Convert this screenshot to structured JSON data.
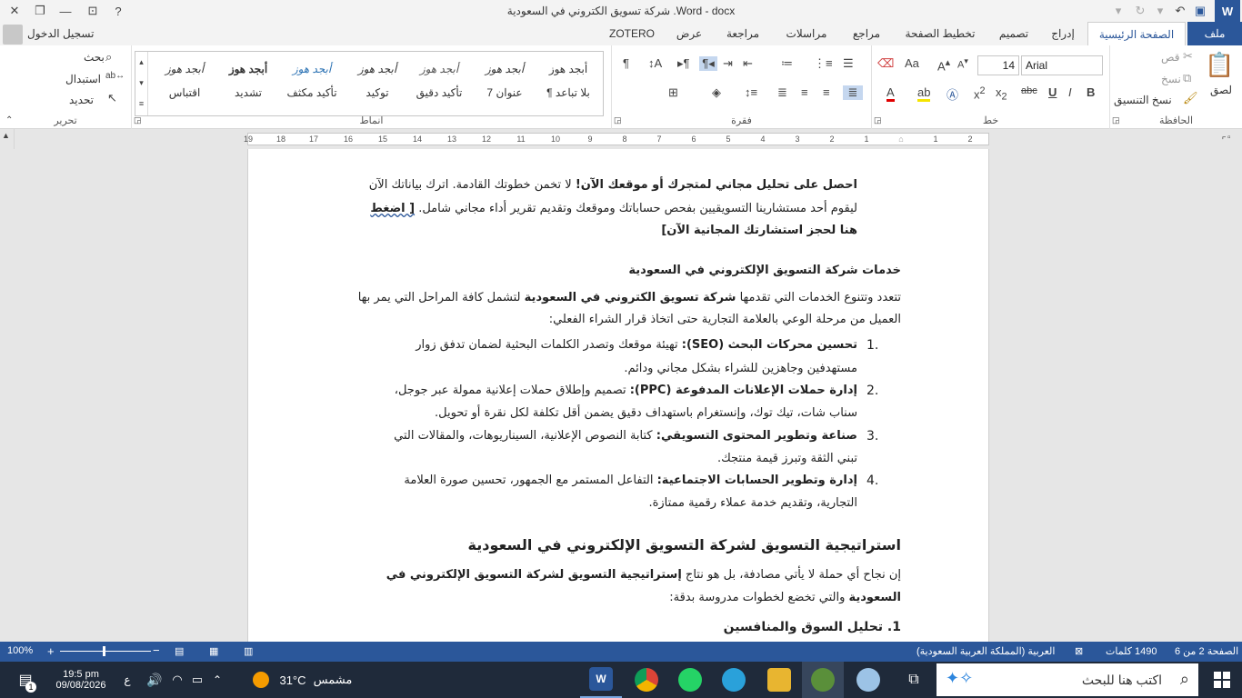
{
  "window": {
    "title": "شركة تسويق الكتروني في السعودية .Word - docx",
    "signin": "تسجيل الدخول"
  },
  "tabs": [
    {
      "label": "ملف"
    },
    {
      "label": "الصفحة الرئيسية"
    },
    {
      "label": "إدراج"
    },
    {
      "label": "تصميم"
    },
    {
      "label": "تخطيط الصفحة"
    },
    {
      "label": "مراجع"
    },
    {
      "label": "مراسلات"
    },
    {
      "label": "مراجعة"
    },
    {
      "label": "عرض"
    },
    {
      "label": "ZOTERO"
    }
  ],
  "ribbon": {
    "clipboard": {
      "paste": "لصق",
      "cut": "قص",
      "copy": "نسخ",
      "format_painter": "نسخ التنسيق",
      "label": "الحافظة"
    },
    "font": {
      "name": "Arial",
      "size": "14",
      "label": "خط"
    },
    "paragraph": {
      "label": "فقرة"
    },
    "styles": {
      "label": "أنماط",
      "items": [
        {
          "sample": "أبجد هوز",
          "name": "¶ بلا تباعد"
        },
        {
          "sample": "أبجد هوز",
          "name": "عنوان 7"
        },
        {
          "sample": "أبجد هوز",
          "name": "تأكيد دقيق"
        },
        {
          "sample": "أبجد هوز",
          "name": "توكيد"
        },
        {
          "sample": "أبجد هوز",
          "name": "تأكيد مكثف"
        },
        {
          "sample": "أبجد هوز",
          "name": "تشديد"
        },
        {
          "sample": "أبجد هوز",
          "name": "اقتباس"
        }
      ]
    },
    "editing": {
      "find": "بحث",
      "replace": "استبدال",
      "select": "تحديد",
      "label": "تحرير"
    }
  },
  "ruler": {
    "ticks": [
      "2",
      "1",
      "",
      "1",
      "2",
      "3",
      "4",
      "5",
      "6",
      "7",
      "8",
      "9",
      "10",
      "11",
      "12",
      "13",
      "14",
      "15",
      "16",
      "17",
      "18",
      "19"
    ]
  },
  "document": {
    "p1": {
      "line1_bold": "احصل على تحليل مجاني لمتجرك أو موقعك الآن!",
      "line1_rest": " لا تخمن خطوتك القادمة. اترك بياناتك الآن",
      "line2_rest": "ليقوم أحد مستشارينا التسويقيين بفحص حساباتك وموقعك وتقديم تقرير أداء مجاني شامل. ",
      "line2_bold": "[ اضغط",
      "line3_bold": "هنا لحجز استشارتك المجانية الآن]"
    },
    "h_services": "خدمات شركة التسويق الإلكتروني في السعودية",
    "p2": {
      "line1_a": "تتعدد وتتنوع الخدمات التي تقدمها ",
      "line1_bold": "شركة تسويق الكتروني في السعودية",
      "line1_b": " لتشمل كافة المراحل التي يمر بها",
      "line2": "العميل من مرحلة الوعي بالعلامة التجارية حتى اتخاذ قرار الشراء الفعلي:"
    },
    "list": [
      {
        "num": "1.",
        "bold": "تحسين محركات البحث (SEO):",
        "l1": " تهيئة موقعك وتصدر الكلمات البحثية لضمان تدفق زوار",
        "l2": "مستهدفين وجاهزين للشراء بشكل مجاني ودائم."
      },
      {
        "num": "2.",
        "bold": "إدارة حملات الإعلانات المدفوعة (PPC):",
        "l1": " تصميم وإطلاق حملات إعلانية ممولة عبر جوجل،",
        "l2": "سناب شات، تيك توك، وإنستغرام باستهداف دقيق يضمن أقل تكلفة لكل نقرة أو تحويل."
      },
      {
        "num": "3.",
        "bold": "صناعة وتطوير المحتوى التسويقي:",
        "l1": " كتابة النصوص الإعلانية، السيناريوهات، والمقالات التي",
        "l2": "تبني الثقة وتبرز قيمة منتجك."
      },
      {
        "num": "4.",
        "bold": "إدارة وتطوير الحسابات الاجتماعية:",
        "l1": " التفاعل المستمر مع الجمهور، تحسين صورة العلامة",
        "l2": "التجارية، وتقديم خدمة عملاء رقمية ممتازة."
      }
    ],
    "h_strategy": "استراتيجية التسويق لشركة التسويق الإلكتروني في السعودية",
    "p3": {
      "line1_a": "إن نجاح أي حملة لا يأتي مصادفة، بل هو نتاج ",
      "line1_bold": "إستراتيجية التسويق لشركة التسويق الإلكتروني في",
      "line2_bold": "السعودية",
      "line2_rest": " والتي تخضع لخطوات مدروسة بدقة:"
    },
    "h_market": "1. تحليل السوق والمنافسين"
  },
  "statusbar": {
    "page": "الصفحة 2 من 6",
    "words": "1490 كلمات",
    "language": "العربية (المملكة العربية السعودية)",
    "zoom": "100%"
  },
  "taskbar": {
    "search_placeholder": "اكتب هنا للبحث",
    "weather_temp": "31°C",
    "weather_desc": "مشمس",
    "time": "19:5 pm",
    "date": "09/08/2026",
    "lang": "ع",
    "notifications": "1"
  },
  "colors": {
    "word_blue": "#2b579a",
    "taskbar": "#1f2a3a"
  }
}
